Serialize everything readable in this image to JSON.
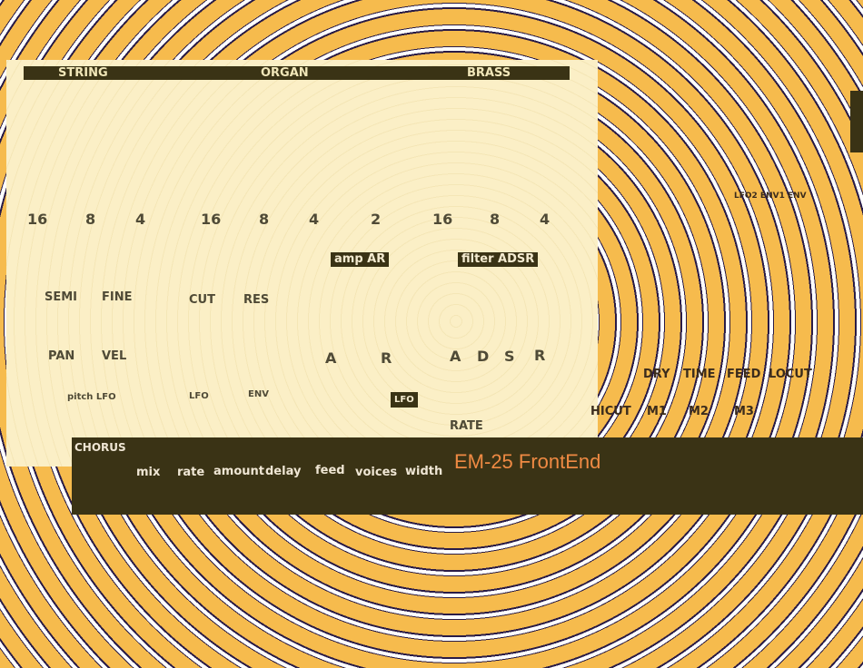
{
  "tabs": [
    "STRING",
    "ORGAN",
    "BRASS"
  ],
  "string_footages": [
    "16",
    "8",
    "4"
  ],
  "organ_footages": [
    "16",
    "8",
    "4",
    "2"
  ],
  "brass_footages": [
    "16",
    "8",
    "4"
  ],
  "sections": {
    "amp": "amp AR",
    "filter": "filter ADSR"
  },
  "string_controls": {
    "semi": "SEMI",
    "fine": "FINE",
    "pan": "PAN",
    "vel": "VEL",
    "pitch_lfo": "pitch LFO"
  },
  "organ_controls": {
    "cut": "CUT",
    "res": "RES",
    "lfo": "LFO",
    "env": "ENV"
  },
  "amp_env": {
    "a": "A",
    "r": "R"
  },
  "filter_env": {
    "a": "A",
    "d": "D",
    "s": "S",
    "r": "R"
  },
  "lfo": {
    "label": "LFO",
    "rate": "RATE"
  },
  "chorus": {
    "title": "CHORUS",
    "params": [
      "mix",
      "rate",
      "amount",
      "delay",
      "feed",
      "voices",
      "width"
    ]
  },
  "brand": "EM-25 FrontEnd",
  "right": {
    "mod_label": "LFO2 ENV1 ENV",
    "delay_params": [
      "DRY",
      "TIME",
      "FEED",
      "LOCUT"
    ],
    "eq_params": [
      "HICUT",
      "M1",
      "M2",
      "M3"
    ]
  },
  "colors": {
    "accent": "#ef8a43",
    "panel": "#fbefc6",
    "dark_bar": "#3a3315",
    "ring_orange": "#f6bb4d",
    "ring_navy": "#2a1c47"
  }
}
